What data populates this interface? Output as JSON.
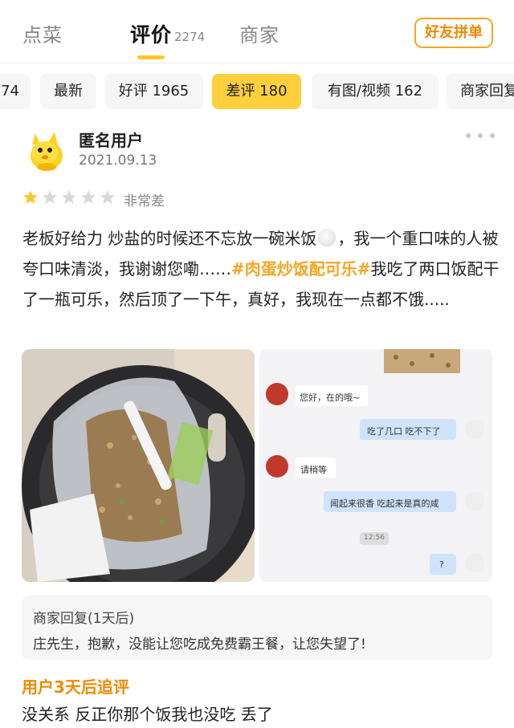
{
  "tabs": {
    "dishes": "点菜",
    "reviews": "评价",
    "reviews_count": "2274",
    "merchant": "商家",
    "group_order_button": "好友拼单"
  },
  "filters": [
    {
      "label": "74",
      "active": false
    },
    {
      "label": "最新",
      "active": false
    },
    {
      "label": "好评 1965",
      "active": false
    },
    {
      "label": "差评 180",
      "active": true
    },
    {
      "label": "有图/视频 162",
      "active": false
    },
    {
      "label": "商家回复",
      "active": false
    }
  ],
  "review": {
    "username": "匿名用户",
    "date": "2021.09.13",
    "avatar_icon": "yellow-kangaroo-avatar-icon",
    "rating": 1,
    "rating_max": 5,
    "rating_text": "非常差",
    "text_part1": "老板好给力  炒盐的时候还不忘放一碗米饭",
    "text_part2": "，我一个重口味的人被夸口味清淡，我谢谢您嘞……",
    "hashtag": "#肉蛋炒饭配可乐#",
    "text_part3": "我吃了两口饭配干了一瓶可乐，然后顶了一下午，真好，我现在一点都不饿.....",
    "photos": [
      {
        "icon": "trash-bin-fried-rice-photo"
      },
      {
        "icon": "chat-screenshot-photo",
        "chat": [
          {
            "from": "merchant",
            "text": "您好，在的哦~"
          },
          {
            "from": "user",
            "text": "吃了几口  吃不下了"
          },
          {
            "from": "merchant",
            "text": "请稍等"
          },
          {
            "from": "user",
            "text": "闻起来很香  吃起来是真的咸"
          },
          {
            "from": "time",
            "text": "12:56"
          },
          {
            "from": "user",
            "text": "?"
          }
        ]
      }
    ]
  },
  "merchant_reply": {
    "title": "商家回复(1天后)",
    "text": "庄先生，抱歉，没能让您吃成免费霸王餐，让您失望了!"
  },
  "followup": {
    "title": "用户3天后追评",
    "text": "没关系  反正你那个饭我也没吃  丢了"
  },
  "colors": {
    "accent": "#ffcf3d",
    "orange": "#f08a00",
    "star_filled": "#ffc72c",
    "star_empty": "#d9d9d9"
  }
}
